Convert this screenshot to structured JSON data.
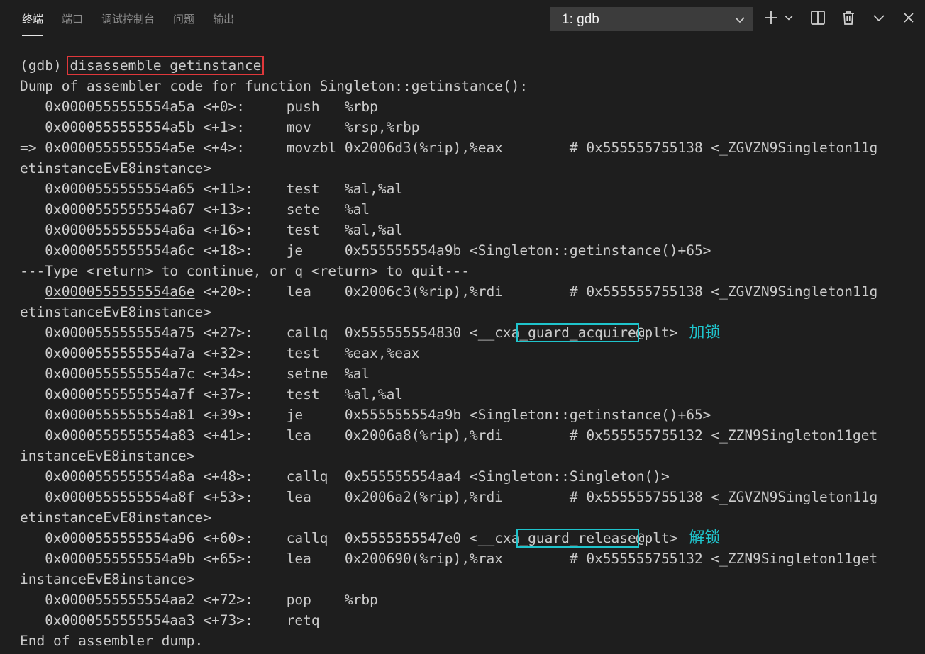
{
  "colors": {
    "background": "#1e1e1e",
    "text": "#cccccc",
    "command_box": "#e0383b",
    "highlight_box": "#1fc4cc",
    "annotation": "#1fc4cc",
    "dropdown_bg": "#3c3c3c"
  },
  "header": {
    "tabs": [
      {
        "label": "终端",
        "active": true
      },
      {
        "label": "端口",
        "active": false
      },
      {
        "label": "调试控制台",
        "active": false
      },
      {
        "label": "问题",
        "active": false
      },
      {
        "label": "输出",
        "active": false
      }
    ],
    "terminal_select": {
      "value": "1: gdb"
    },
    "icons": [
      "chevron-down-icon",
      "plus-icon",
      "chevron-down-icon",
      "split-icon",
      "trash-icon",
      "chevron-up-down-icon",
      "close-icon"
    ]
  },
  "terminal": {
    "lines": [
      [
        {
          "t": "(gdb) "
        },
        {
          "t": "disassemble getinstance",
          "box": "red"
        }
      ],
      [
        {
          "t": "Dump of assembler code for function Singleton::getinstance():"
        }
      ],
      [
        {
          "t": "   0x0000555555554a5a <+0>:\tpush   %rbp"
        }
      ],
      [
        {
          "t": "   0x0000555555554a5b <+1>:\tmov    %rsp,%rbp"
        }
      ],
      [
        {
          "t": "=> 0x0000555555554a5e <+4>:\tmovzbl 0x2006d3(%rip),%eax        # 0x555555755138 <_ZGVZN9Singleton11g"
        }
      ],
      [
        {
          "t": "etinstanceEvE8instance>"
        }
      ],
      [
        {
          "t": "   0x0000555555554a65 <+11>:\ttest   %al,%al"
        }
      ],
      [
        {
          "t": "   0x0000555555554a67 <+13>:\tsete   %al"
        }
      ],
      [
        {
          "t": "   0x0000555555554a6a <+16>:\ttest   %al,%al"
        }
      ],
      [
        {
          "t": "   0x0000555555554a6c <+18>:\tje     0x555555554a9b <Singleton::getinstance()+65>"
        }
      ],
      [
        {
          "t": "---Type <return> to continue, or q <return> to quit---"
        }
      ],
      [
        {
          "t": "   "
        },
        {
          "t": "0x0000555555554a6e",
          "u": true
        },
        {
          "t": " <+20>:\tlea    0x2006c3(%rip),%rdi        # 0x555555755138 <_ZGVZN9Singleton11g"
        }
      ],
      [
        {
          "t": "etinstanceEvE8instance>"
        }
      ],
      [
        {
          "t": "   0x0000555555554a75 <+27>:\tcallq  0x555555554830 <__cxa"
        },
        {
          "t": "_guard_acquire",
          "box": "cyan"
        },
        {
          "t": "@plt>"
        }
      ],
      [
        {
          "t": "   0x0000555555554a7a <+32>:\ttest   %eax,%eax"
        }
      ],
      [
        {
          "t": "   0x0000555555554a7c <+34>:\tsetne  %al"
        }
      ],
      [
        {
          "t": "   0x0000555555554a7f <+37>:\ttest   %al,%al"
        }
      ],
      [
        {
          "t": "   0x0000555555554a81 <+39>:\tje     0x555555554a9b <Singleton::getinstance()+65>"
        }
      ],
      [
        {
          "t": "   0x0000555555554a83 <+41>:\tlea    0x2006a8(%rip),%rdi        # 0x555555755132 <_ZZN9Singleton11get"
        }
      ],
      [
        {
          "t": "instanceEvE8instance>"
        }
      ],
      [
        {
          "t": "   0x0000555555554a8a <+48>:\tcallq  0x555555554aa4 <Singleton::Singleton()>"
        }
      ],
      [
        {
          "t": "   0x0000555555554a8f <+53>:\tlea    0x2006a2(%rip),%rdi        # 0x555555755138 <_ZGVZN9Singleton11g"
        }
      ],
      [
        {
          "t": "etinstanceEvE8instance>"
        }
      ],
      [
        {
          "t": "   0x0000555555554a96 <+60>:\tcallq  0x5555555547e0 <__cxa"
        },
        {
          "t": "_guard_release",
          "box": "cyan"
        },
        {
          "t": "@plt>"
        }
      ],
      [
        {
          "t": "   0x0000555555554a9b <+65>:\tlea    0x200690(%rip),%rax        # 0x555555755132 <_ZZN9Singleton11get"
        }
      ],
      [
        {
          "t": "instanceEvE8instance>"
        }
      ],
      [
        {
          "t": "   0x0000555555554aa2 <+72>:\tpop    %rbp"
        }
      ],
      [
        {
          "t": "   0x0000555555554aa3 <+73>:\tretq"
        }
      ],
      [
        {
          "t": "End of assembler dump."
        }
      ]
    ],
    "annotations": [
      {
        "line": 13,
        "text": "加锁"
      },
      {
        "line": 23,
        "text": "解锁"
      }
    ]
  }
}
